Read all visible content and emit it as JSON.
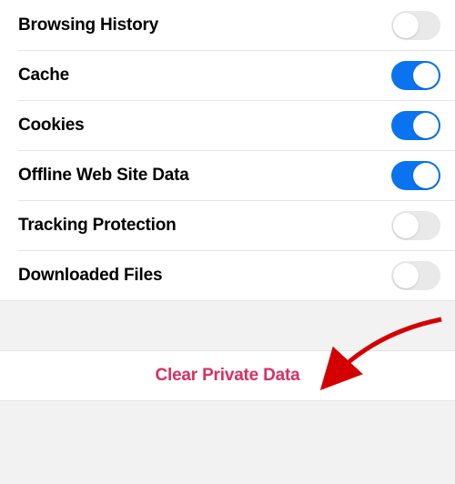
{
  "rows": [
    {
      "key": "browsing-history",
      "label": "Browsing History",
      "on": false
    },
    {
      "key": "cache",
      "label": "Cache",
      "on": true
    },
    {
      "key": "cookies",
      "label": "Cookies",
      "on": true
    },
    {
      "key": "offline-data",
      "label": "Offline Web Site Data",
      "on": true
    },
    {
      "key": "tracking-protection",
      "label": "Tracking Protection",
      "on": false
    },
    {
      "key": "downloaded-files",
      "label": "Downloaded Files",
      "on": false
    }
  ],
  "action": {
    "label": "Clear Private Data"
  },
  "colors": {
    "accent": "#0a73f0",
    "destructive": "#d93060"
  }
}
